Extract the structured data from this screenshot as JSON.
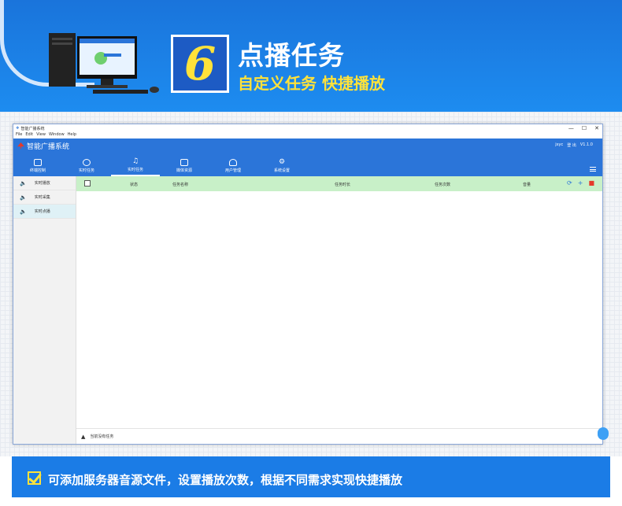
{
  "banner": {
    "number": "6",
    "title": "点播任务",
    "subtitle": "自定义任务 快捷播放"
  },
  "window": {
    "titlebar": "智能广播系统",
    "controls": [
      "—",
      "☐",
      "✕"
    ],
    "menu": [
      "File",
      "Edit",
      "View",
      "Window",
      "Help"
    ],
    "app_title": "智能广播系统",
    "user": "jxyc",
    "logout": "登 出",
    "version": "V1.1.0",
    "tabs": [
      {
        "label": "终端控制",
        "icon": "monitor-icon"
      },
      {
        "label": "实时任务",
        "icon": "clock-icon"
      },
      {
        "label": "实时任务",
        "icon": "music-icon"
      },
      {
        "label": "媒体资源",
        "icon": "media-icon"
      },
      {
        "label": "用户管理",
        "icon": "user-icon"
      },
      {
        "label": "系统设置",
        "icon": "gear-icon"
      }
    ],
    "active_tab_index": 2,
    "sidebar": [
      {
        "label": "实时播放",
        "icon": "speaker-icon"
      },
      {
        "label": "实时采集",
        "icon": "speaker-icon"
      },
      {
        "label": "实时点播",
        "icon": "speaker-icon"
      }
    ],
    "table_headers": [
      "状态",
      "任务名称",
      "任务时长",
      "任务次数",
      "音量"
    ],
    "actions": [
      "refresh-icon",
      "add-icon",
      "delete-icon"
    ],
    "footer_text": "当前没有任务"
  },
  "bottom": {
    "text": "可添加服务器音源文件，设置播放次数，根据不同需求实现快捷播放"
  },
  "colors": {
    "banner_blue": "#1d8cf0",
    "accent_yellow": "#ffe23a",
    "header_blue": "#2b75d9",
    "table_header_green": "#c8f0c8"
  }
}
